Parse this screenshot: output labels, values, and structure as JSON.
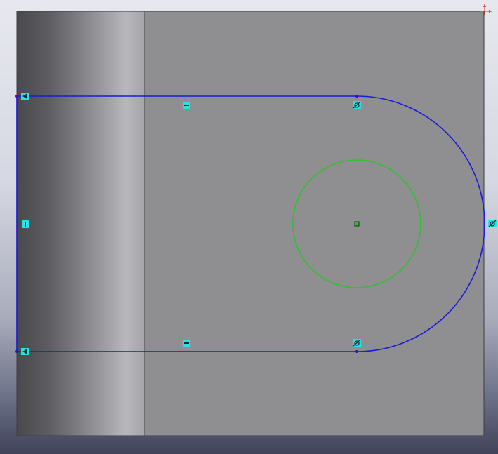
{
  "viewport": {
    "title": "",
    "colors": {
      "background_top": "#e7e8ef",
      "background_bottom": "#3f4259",
      "face": "#8f8e90",
      "face_edge": "#3d3d40",
      "sketch_line": "#1a1ad8",
      "construction_circle": "#2fbf2f",
      "relation_glyph": "#25e1e8",
      "origin": "#e53030"
    }
  },
  "sketch": {
    "entities": [
      {
        "type": "line",
        "name": "top-line"
      },
      {
        "type": "line",
        "name": "bottom-line"
      },
      {
        "type": "line",
        "name": "left-line"
      },
      {
        "type": "arc",
        "name": "end-arc"
      },
      {
        "type": "circle",
        "name": "hole-circle"
      }
    ],
    "relations": [
      {
        "icon": "coincident-icon",
        "name": "top-left-corner"
      },
      {
        "icon": "coincident-icon",
        "name": "bottom-left-corner"
      },
      {
        "icon": "horizontal-icon",
        "name": "top-line"
      },
      {
        "icon": "horizontal-icon",
        "name": "bottom-line"
      },
      {
        "icon": "vertical-icon",
        "name": "left-line"
      },
      {
        "icon": "tangent-icon",
        "name": "top-arc-tangent"
      },
      {
        "icon": "tangent-icon",
        "name": "bottom-arc-tangent"
      },
      {
        "icon": "tangent-icon",
        "name": "arc-right-tangent"
      },
      {
        "icon": "fix-point-icon",
        "name": "circle-center"
      }
    ]
  },
  "origin": {
    "icon": "origin-icon"
  }
}
